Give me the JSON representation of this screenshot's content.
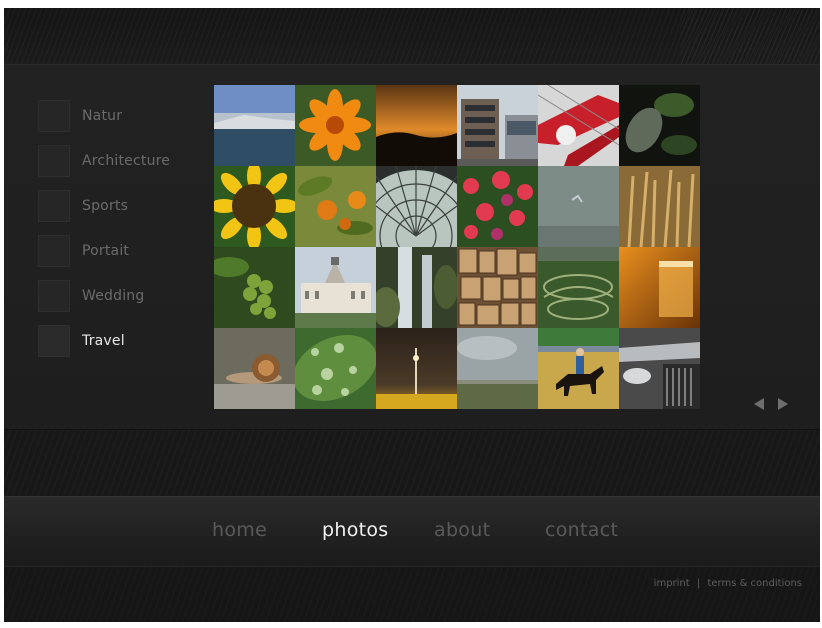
{
  "categories": [
    {
      "label": "Natur",
      "active": false
    },
    {
      "label": "Architecture",
      "active": false
    },
    {
      "label": "Sports",
      "active": false
    },
    {
      "label": "Portait",
      "active": false
    },
    {
      "label": "Wedding",
      "active": false
    },
    {
      "label": "Travel",
      "active": true
    }
  ],
  "gallery": {
    "thumbnails": [
      "coastline-sea",
      "orange-flower",
      "sunset-sky",
      "modern-building",
      "red-structure",
      "leaves-plant",
      "sunflower",
      "orange-fruits",
      "glass-dome",
      "red-flowers",
      "foggy-sky",
      "wheat-field",
      "green-grapes",
      "palace",
      "waterfall",
      "stacked-wood",
      "formal-garden",
      "whisky-glass",
      "snail",
      "water-drops-leaf",
      "night-tower",
      "cloudy-landscape",
      "horse-rider",
      "car-grille"
    ],
    "prev_icon": "triangle-left-icon",
    "next_icon": "triangle-right-icon"
  },
  "nav": {
    "items": [
      {
        "label": "home",
        "active": false
      },
      {
        "label": "photos",
        "active": true
      },
      {
        "label": "about",
        "active": false
      },
      {
        "label": "contact",
        "active": false
      }
    ]
  },
  "footer": {
    "imprint": "imprint",
    "separator": "|",
    "terms": "terms & conditions"
  },
  "colors": {
    "background": "#1c1c1c",
    "active_text": "#f0f0f0",
    "inactive_text": "#5a5a5a"
  }
}
